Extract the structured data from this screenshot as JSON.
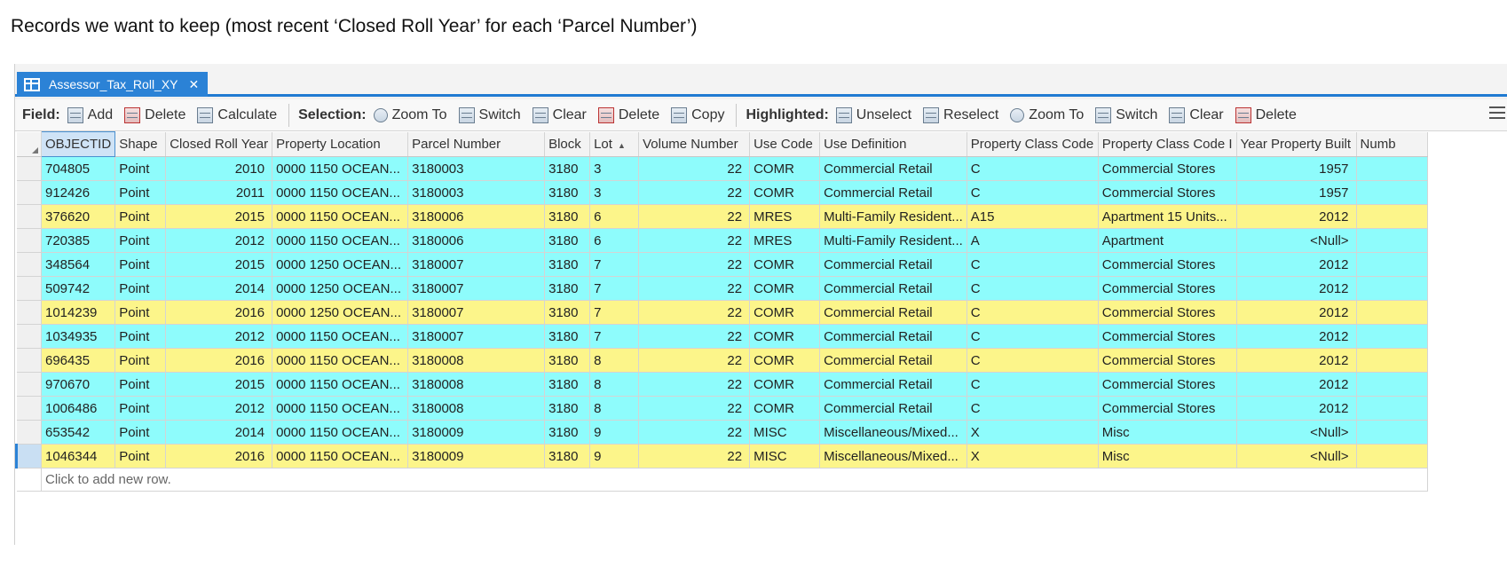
{
  "caption": "Records we want to keep (most recent ‘Closed Roll Year’ for each ‘Parcel Number’)",
  "tab": {
    "title": "Assessor_Tax_Roll_XY",
    "close": "✕"
  },
  "toolbar": {
    "field_label": "Field:",
    "add": "Add",
    "delete": "Delete",
    "calculate": "Calculate",
    "selection_label": "Selection:",
    "zoom_to": "Zoom To",
    "switch": "Switch",
    "clear": "Clear",
    "sel_delete": "Delete",
    "copy": "Copy",
    "highlighted_label": "Highlighted:",
    "unselect": "Unselect",
    "reselect": "Reselect",
    "hl_zoom_to": "Zoom To",
    "hl_switch": "Switch",
    "hl_clear": "Clear",
    "hl_delete": "Delete"
  },
  "columns": [
    "OBJECTID",
    "Shape",
    "Closed Roll Year",
    "Property Location",
    "Parcel Number",
    "Block",
    "Lot",
    "Volume Number",
    "Use Code",
    "Use Definition",
    "Property Class Code",
    "Property Class Code I",
    "Year Property Built",
    "Numb"
  ],
  "rows": [
    {
      "c": [
        "704805",
        "Point",
        "2010",
        "0000 1150 OCEAN...",
        "3180003",
        "3180",
        "3",
        "22",
        "COMR",
        "Commercial Retail",
        "C",
        "Commercial Stores",
        "1957",
        ""
      ]
    },
    {
      "c": [
        "912426",
        "Point",
        "2011",
        "0000 1150 OCEAN...",
        "3180003",
        "3180",
        "3",
        "22",
        "COMR",
        "Commercial Retail",
        "C",
        "Commercial Stores",
        "1957",
        ""
      ]
    },
    {
      "c": [
        "376620",
        "Point",
        "2015",
        "0000 1150 OCEAN...",
        "3180006",
        "3180",
        "6",
        "22",
        "MRES",
        "Multi-Family Resident...",
        "A15",
        "Apartment 15 Units...",
        "2012",
        ""
      ]
    },
    {
      "c": [
        "720385",
        "Point",
        "2012",
        "0000 1150 OCEAN...",
        "3180006",
        "3180",
        "6",
        "22",
        "MRES",
        "Multi-Family Resident...",
        "A",
        "Apartment",
        "<Null>",
        ""
      ]
    },
    {
      "c": [
        "348564",
        "Point",
        "2015",
        "0000 1250 OCEAN...",
        "3180007",
        "3180",
        "7",
        "22",
        "COMR",
        "Commercial Retail",
        "C",
        "Commercial Stores",
        "2012",
        ""
      ]
    },
    {
      "c": [
        "509742",
        "Point",
        "2014",
        "0000 1250 OCEAN...",
        "3180007",
        "3180",
        "7",
        "22",
        "COMR",
        "Commercial Retail",
        "C",
        "Commercial Stores",
        "2012",
        ""
      ]
    },
    {
      "c": [
        "1014239",
        "Point",
        "2016",
        "0000 1250 OCEAN...",
        "3180007",
        "3180",
        "7",
        "22",
        "COMR",
        "Commercial Retail",
        "C",
        "Commercial Stores",
        "2012",
        ""
      ]
    },
    {
      "c": [
        "1034935",
        "Point",
        "2012",
        "0000 1150 OCEAN...",
        "3180007",
        "3180",
        "7",
        "22",
        "COMR",
        "Commercial Retail",
        "C",
        "Commercial Stores",
        "2012",
        ""
      ]
    },
    {
      "c": [
        "696435",
        "Point",
        "2016",
        "0000 1150 OCEAN...",
        "3180008",
        "3180",
        "8",
        "22",
        "COMR",
        "Commercial Retail",
        "C",
        "Commercial Stores",
        "2012",
        ""
      ]
    },
    {
      "c": [
        "970670",
        "Point",
        "2015",
        "0000 1150 OCEAN...",
        "3180008",
        "3180",
        "8",
        "22",
        "COMR",
        "Commercial Retail",
        "C",
        "Commercial Stores",
        "2012",
        ""
      ]
    },
    {
      "c": [
        "1006486",
        "Point",
        "2012",
        "0000 1150 OCEAN...",
        "3180008",
        "3180",
        "8",
        "22",
        "COMR",
        "Commercial Retail",
        "C",
        "Commercial Stores",
        "2012",
        ""
      ]
    },
    {
      "c": [
        "653542",
        "Point",
        "2014",
        "0000 1150 OCEAN...",
        "3180009",
        "3180",
        "9",
        "22",
        "MISC",
        "Miscellaneous/Mixed...",
        "X",
        "Misc",
        "<Null>",
        ""
      ]
    },
    {
      "c": [
        "1046344",
        "Point",
        "2016",
        "0000 1150 OCEAN...",
        "3180009",
        "3180",
        "9",
        "22",
        "MISC",
        "Miscellaneous/Mixed...",
        "X",
        "Misc",
        "<Null>",
        ""
      ]
    }
  ],
  "row_highlight": [
    "cyan",
    "cyan",
    "yellow",
    "cyan",
    "cyan",
    "cyan",
    "yellow",
    "cyan",
    "yellow",
    "cyan",
    "cyan",
    "cyan",
    "yellow"
  ],
  "active_row": 12,
  "add_row_text": "Click to add new row.",
  "colors": {
    "keep": "#fcf58a",
    "discard": "#8efcfc",
    "accent": "#2b82d6"
  }
}
